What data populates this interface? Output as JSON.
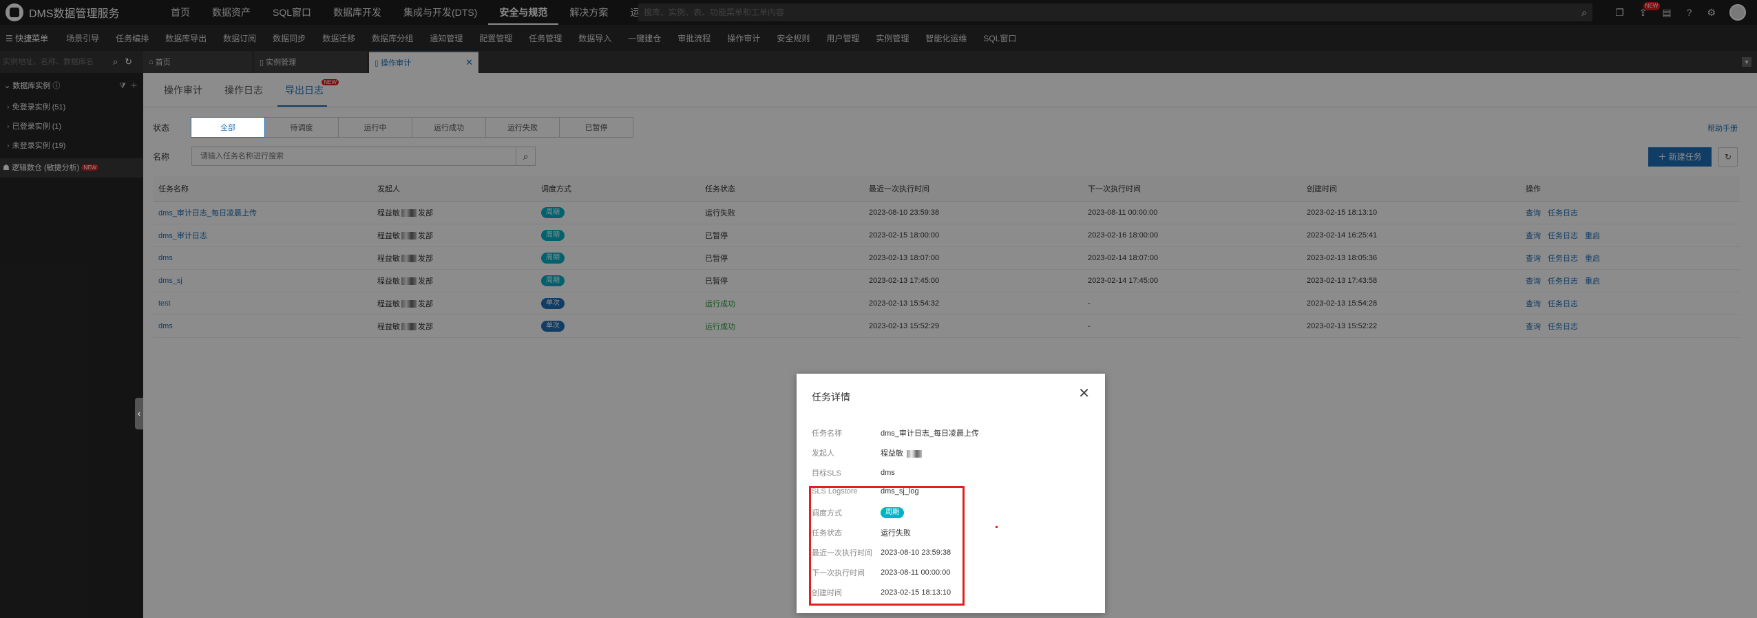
{
  "app": {
    "title": "DMS数据管理服务"
  },
  "topnav": [
    "首页",
    "数据资产",
    "SQL窗口",
    "数据库开发",
    "集成与开发(DTS)",
    "安全与规范",
    "解决方案",
    "运维管理"
  ],
  "topnav_active": "安全与规范",
  "global_search": {
    "placeholder": "搜库、实例、表、功能菜单和工单内容"
  },
  "top_icons": {
    "new_badge": "NEW"
  },
  "subbar": {
    "quickmenu": "快捷菜单",
    "items": [
      "场景引导",
      "任务编排",
      "数据库导出",
      "数据订阅",
      "数据同步",
      "数据迁移",
      "数据库分组",
      "通知管理",
      "配置管理",
      "任务管理",
      "数据导入",
      "一键建仓",
      "审批流程",
      "操作审计",
      "安全规则",
      "用户管理",
      "实例管理",
      "智能化运维",
      "SQL窗口"
    ]
  },
  "left_search": {
    "placeholder": "实例地址、名称、数据库名"
  },
  "tabs": [
    {
      "label": "首页"
    },
    {
      "label": "实例管理"
    },
    {
      "label": "操作审计"
    }
  ],
  "sidebar": {
    "header": "数据库实例",
    "items": [
      {
        "label": "免登录实例 (51)"
      },
      {
        "label": "已登录实例 (1)"
      },
      {
        "label": "未登录实例 (19)"
      }
    ],
    "logic": {
      "label": "逻辑数仓 (敏捷分析)",
      "badge": "NEW"
    }
  },
  "content": {
    "tabs": [
      "操作审计",
      "操作日志",
      "导出日志"
    ],
    "tab_badge": "NEW",
    "status_label": "状态",
    "statuses": [
      "全部",
      "待调度",
      "运行中",
      "运行成功",
      "运行失败",
      "已暂停"
    ],
    "name_label": "名称",
    "name_placeholder": "请输入任务名称进行搜索",
    "help": "帮助手册",
    "new_task": "新建任务",
    "columns": [
      "任务名称",
      "发起人",
      "调度方式",
      "任务状态",
      "最近一次执行时间",
      "下一次执行时间",
      "创建时间",
      "操作"
    ],
    "rows": [
      {
        "name": "dms_审计日志_每日凌晨上传",
        "owner_a": "程益敏",
        "owner_b": "发部",
        "mode": "周期",
        "mode_type": "cycle",
        "status": "运行失败",
        "status_type": "fail",
        "last": "2023-08-10 23:59:38",
        "next": "2023-08-11 00:00:00",
        "created": "2023-02-15 18:13:10",
        "ops": [
          "查询",
          "任务日志"
        ]
      },
      {
        "name": "dms_审计日志",
        "owner_a": "程益敏",
        "owner_b": "发部",
        "mode": "周期",
        "mode_type": "cycle",
        "status": "已暂停",
        "status_type": "fail",
        "last": "2023-02-15 18:00:00",
        "next": "2023-02-16 18:00:00",
        "created": "2023-02-14 16:25:41",
        "ops": [
          "查询",
          "任务日志",
          "重启"
        ]
      },
      {
        "name": "dms",
        "owner_a": "程益敏",
        "owner_b": "发部",
        "mode": "周期",
        "mode_type": "cycle",
        "status": "已暂停",
        "status_type": "fail",
        "last": "2023-02-13 18:07:00",
        "next": "2023-02-14 18:07:00",
        "created": "2023-02-13 18:05:36",
        "ops": [
          "查询",
          "任务日志",
          "重启"
        ]
      },
      {
        "name": "dms_sj",
        "owner_a": "程益敏",
        "owner_b": "发部",
        "mode": "周期",
        "mode_type": "cycle",
        "status": "已暂停",
        "status_type": "fail",
        "last": "2023-02-13 17:45:00",
        "next": "2023-02-14 17:45:00",
        "created": "2023-02-13 17:43:58",
        "ops": [
          "查询",
          "任务日志",
          "重启"
        ]
      },
      {
        "name": "test",
        "owner_a": "程益敏",
        "owner_b": "发部",
        "mode": "单次",
        "mode_type": "once",
        "status": "运行成功",
        "status_type": "ok",
        "last": "2023-02-13 15:54:32",
        "next": "-",
        "created": "2023-02-13 15:54:28",
        "ops": [
          "查询",
          "任务日志"
        ]
      },
      {
        "name": "dms",
        "owner_a": "程益敏",
        "owner_b": "发部",
        "mode": "单次",
        "mode_type": "once",
        "status": "运行成功",
        "status_type": "ok",
        "last": "2023-02-13 15:52:29",
        "next": "-",
        "created": "2023-02-13 15:52:22",
        "ops": [
          "查询",
          "任务日志"
        ]
      }
    ]
  },
  "modal": {
    "title": "任务详情",
    "fields": [
      {
        "key": "任务名称",
        "value": "dms_审计日志_每日凌晨上传"
      },
      {
        "key": "发起人",
        "value": "程益敏"
      },
      {
        "key": "目标SLS",
        "value": "dms"
      },
      {
        "key": "SLS Logstore",
        "value": "dms_sj_log"
      },
      {
        "key": "调度方式",
        "value": "周期"
      },
      {
        "key": "任务状态",
        "value": "运行失败"
      },
      {
        "key": "最近一次执行时间",
        "value": "2023-08-10 23:59:38"
      },
      {
        "key": "下一次执行时间",
        "value": "2023-08-11 00:00:00"
      },
      {
        "key": "创建时间",
        "value": "2023-02-15 18:13:10"
      }
    ]
  },
  "colors": {
    "accent": "#1e6fb8",
    "cycle_pill": "#00b3c8",
    "success": "#2c9d3b",
    "highlight": "#e02020"
  }
}
